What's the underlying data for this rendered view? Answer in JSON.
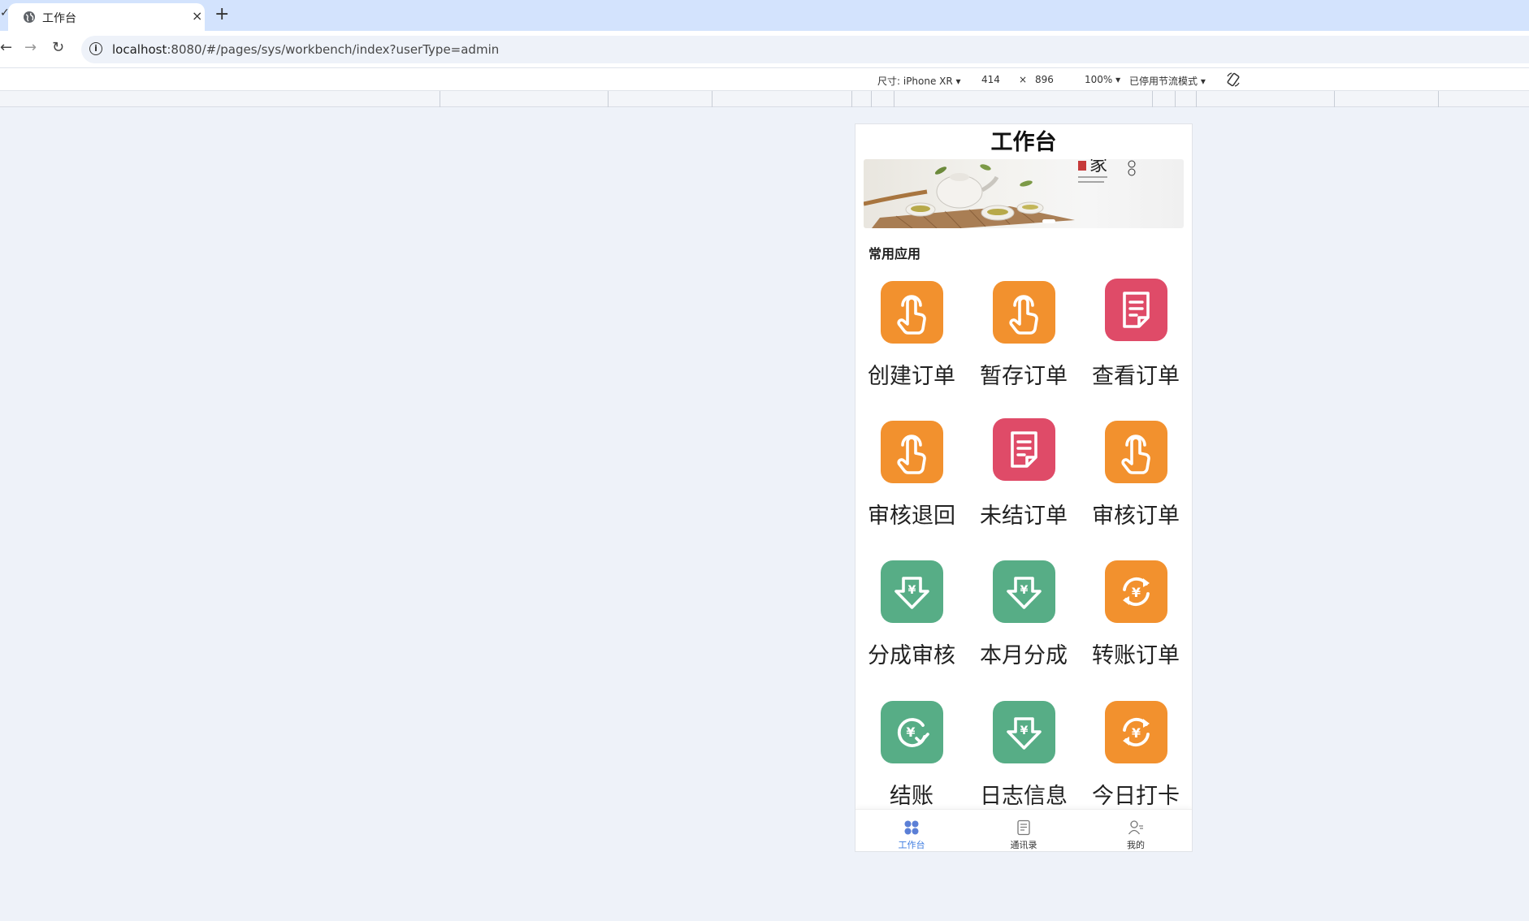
{
  "browser": {
    "tab_title": "工作台",
    "close_glyph": "×",
    "new_tab_glyph": "+",
    "url_host": "localhost",
    "url_rest": ":8080/#/pages/sys/workbench/index?userType=admin"
  },
  "devtools": {
    "size_label": "尺寸: iPhone XR ▾",
    "width": "414",
    "times": "×",
    "height": "896",
    "zoom": "100% ▾",
    "throttle": "已停用节流模式 ▾"
  },
  "app": {
    "title": "工作台",
    "section_title": "常用应用",
    "apps": [
      {
        "label": "创建订单",
        "color": "#f2912e",
        "icon": "hand-pointer-icon"
      },
      {
        "label": "暂存订单",
        "color": "#f2912e",
        "icon": "hand-pointer-icon"
      },
      {
        "label": "查看订单",
        "color": "#df4b68",
        "icon": "document-icon"
      },
      {
        "label": "审核退回",
        "color": "#f2912e",
        "icon": "hand-pointer-icon"
      },
      {
        "label": "未结订单",
        "color": "#df4b68",
        "icon": "document-icon"
      },
      {
        "label": "审核订单",
        "color": "#f2912e",
        "icon": "hand-pointer-icon"
      },
      {
        "label": "分成审核",
        "color": "#57ad86",
        "icon": "yen-download-icon"
      },
      {
        "label": "本月分成",
        "color": "#57ad86",
        "icon": "yen-download-icon"
      },
      {
        "label": "转账订单",
        "color": "#f2912e",
        "icon": "yen-cycle-icon"
      },
      {
        "label": "结账",
        "color": "#57ad86",
        "icon": "yen-check-icon"
      },
      {
        "label": "日志信息",
        "color": "#57ad86",
        "icon": "yen-download-icon"
      },
      {
        "label": "今日打卡",
        "color": "#f2912e",
        "icon": "yen-cycle-icon"
      }
    ],
    "bottom_tabs": [
      {
        "label": "工作台",
        "icon": "grid-icon",
        "active": true
      },
      {
        "label": "通讯录",
        "icon": "contacts-book-icon",
        "active": false
      },
      {
        "label": "我的",
        "icon": "user-icon",
        "active": false
      }
    ]
  }
}
